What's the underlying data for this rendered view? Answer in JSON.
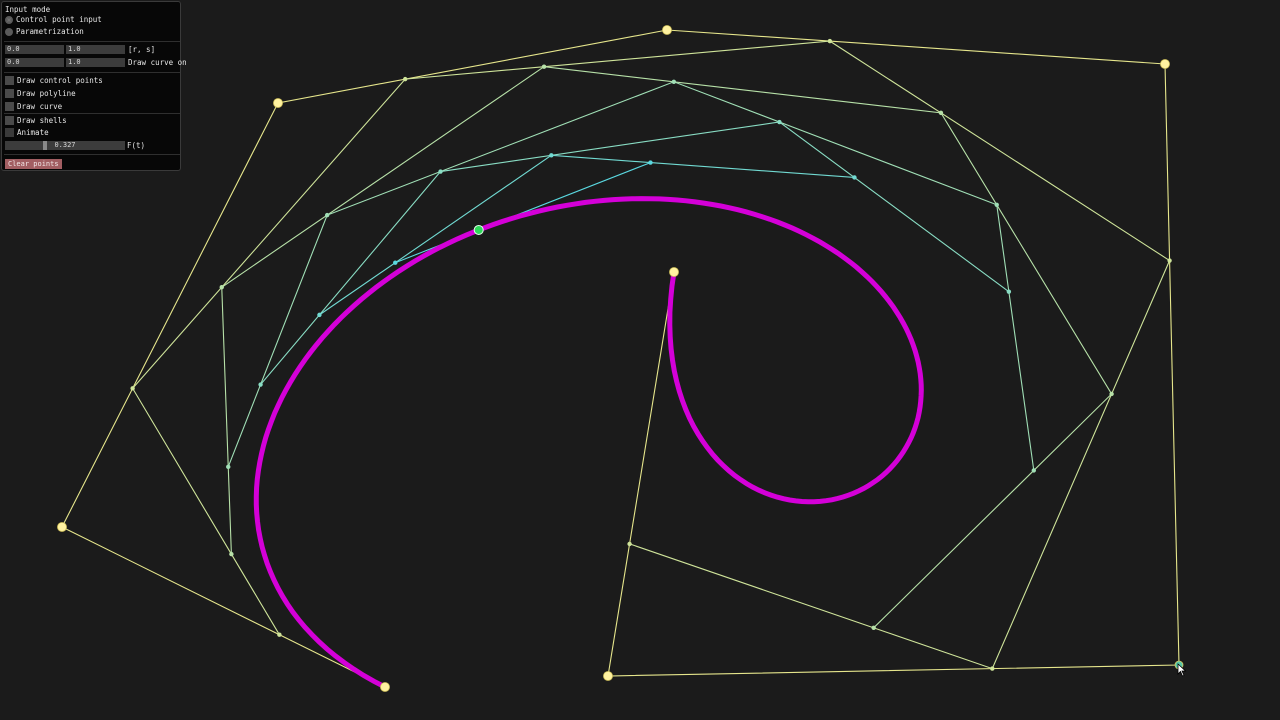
{
  "panel": {
    "heading": "Input mode",
    "modes": [
      {
        "label": "Control point input",
        "selected": true
      },
      {
        "label": "Parametrization",
        "selected": false
      }
    ],
    "range_row": {
      "r": "0.0",
      "s": "1.0",
      "label": "[r, s]"
    },
    "draw_row": {
      "r": "0.0",
      "s": "1.0",
      "label": "Draw curve on"
    },
    "toggles": {
      "draw_control_points": "Draw control points",
      "draw_polyline": "Draw polyline",
      "draw_curve": "Draw curve",
      "draw_shells": "Draw shells",
      "animate": "Animate"
    },
    "slider": {
      "value": "0.327",
      "fraction": 0.327,
      "label": "F(t)"
    },
    "clear_button": "Clear points"
  },
  "colors": {
    "background": "#1b1b1b",
    "control_polygon": "#e6e68c",
    "curve": "#d400d8",
    "current_point": "#2fd85a"
  },
  "icons": {
    "cursor": "arrow-cursor-icon"
  }
}
